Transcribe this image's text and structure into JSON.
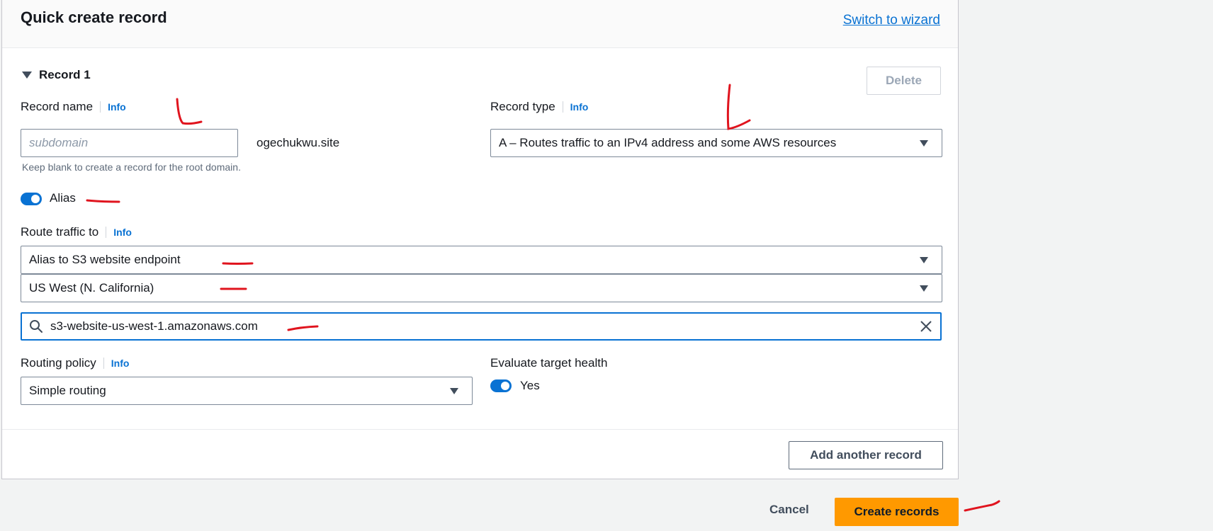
{
  "panel": {
    "title": "Quick create record",
    "switch_link": "Switch to wizard"
  },
  "record": {
    "heading": "Record 1",
    "delete_label": "Delete",
    "record_name": {
      "label": "Record name",
      "info": "Info",
      "placeholder": "subdomain",
      "value": "",
      "suffix": "ogechukwu.site",
      "hint": "Keep blank to create a record for the root domain."
    },
    "record_type": {
      "label": "Record type",
      "info": "Info",
      "value": "A – Routes traffic to an IPv4 address and some AWS resources"
    },
    "alias": {
      "label": "Alias",
      "enabled": true
    },
    "route_traffic": {
      "label": "Route traffic to",
      "info": "Info",
      "endpoint": "Alias to S3 website endpoint",
      "region": "US West (N. California)",
      "search_value": "s3-website-us-west-1.amazonaws.com"
    },
    "routing_policy": {
      "label": "Routing policy",
      "info": "Info",
      "value": "Simple routing"
    },
    "evaluate_health": {
      "label": "Evaluate target health",
      "toggle_label": "Yes",
      "enabled": true
    },
    "add_another": "Add another record"
  },
  "footer": {
    "cancel": "Cancel",
    "create": "Create records"
  },
  "colors": {
    "link": "#0972d3",
    "primary_button": "#ff9900",
    "annotation": "#e0141e"
  }
}
